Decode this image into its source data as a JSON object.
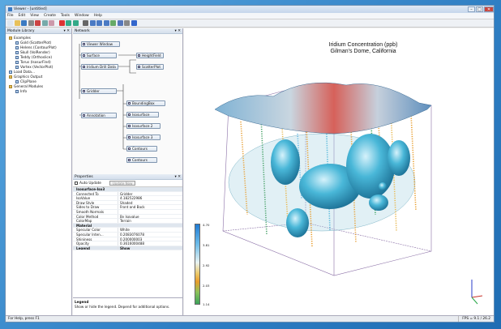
{
  "window": {
    "title": "Viewer - [untitled]"
  },
  "menu": [
    "File",
    "Edit",
    "View",
    "Create",
    "Tools",
    "Window",
    "Help"
  ],
  "toolbar_icons": [
    "new-icon",
    "open-icon",
    "save-icon",
    "print-icon",
    "cut-icon",
    "copy-icon",
    "paste-icon",
    "delete-icon",
    "undo-icon",
    "redo-icon",
    "pointer-icon",
    "zoom-icon",
    "rotate-icon",
    "pan-icon",
    "camera-icon",
    "view-icon",
    "settings-icon",
    "help-icon"
  ],
  "left_panel": {
    "title": "Module Library",
    "items": [
      {
        "label": "Examples",
        "level": 0,
        "type": "folder"
      },
      {
        "label": "Gold (ScatterPlot)",
        "level": 1,
        "type": "mod"
      },
      {
        "label": "Helens (ContourPlot)",
        "level": 1,
        "type": "mod"
      },
      {
        "label": "Skull (VolRender)",
        "level": 1,
        "type": "mod"
      },
      {
        "label": "Teddy (Orthoslice)",
        "level": 1,
        "type": "mod"
      },
      {
        "label": "Torus (IsosurFind)",
        "level": 1,
        "type": "mod"
      },
      {
        "label": "Vortex (VectorPlot)",
        "level": 1,
        "type": "mod"
      },
      {
        "label": "Load Data...",
        "level": 0,
        "type": "mod"
      },
      {
        "label": "Graphics Output",
        "level": 0,
        "type": "folder"
      },
      {
        "label": "ClipPlane",
        "level": 1,
        "type": "mod"
      },
      {
        "label": "General Modules",
        "level": 0,
        "type": "folder"
      },
      {
        "label": "Info",
        "level": 1,
        "type": "mod"
      }
    ]
  },
  "network": {
    "title": "Network",
    "nodes": [
      "Viewer Window",
      "Surface",
      "HeightField",
      "Iridium Drill Data",
      "ScatterPlot",
      "Gridder",
      "BoundingBox",
      "Isosurface",
      "Isosurface 2",
      "Isosurface 3",
      "Annotation",
      "Contours",
      "Contours"
    ]
  },
  "properties": {
    "title": "Properties",
    "auto_update": "Auto Update",
    "update_now": "Update Now",
    "rows": [
      {
        "k": "Isosurface-Iso3",
        "v": "",
        "section": true
      },
      {
        "k": "Connected To",
        "v": "Gridder"
      },
      {
        "k": "IsoValue",
        "v": "4.182522986"
      },
      {
        "k": "Draw Style",
        "v": "Shaded"
      },
      {
        "k": "Sides to Draw",
        "v": "Front and Back"
      },
      {
        "k": "Smooth Normals",
        "v": ""
      },
      {
        "k": "Color Method",
        "v": "By Isovalue"
      },
      {
        "k": "ColorMap",
        "v": "Terrain"
      },
      {
        "k": "Material",
        "v": "",
        "section": true
      },
      {
        "k": "Specular Color",
        "v": "White"
      },
      {
        "k": "Specular Inten...",
        "v": "0.2083076078"
      },
      {
        "k": "Shininess",
        "v": "0.200000003"
      },
      {
        "k": "Opacity",
        "v": "0.3616000488"
      },
      {
        "k": "Legend",
        "v": "Show",
        "section": true
      }
    ]
  },
  "legend_help": {
    "title": "Legend",
    "text": "Show or hide the legend. Depend for additional options."
  },
  "viewer": {
    "title_line1": "Iridium Concentration (ppb)",
    "title_line2": "Gilman's Dome, California",
    "colorbar_labels": [
      "4.70",
      "3.81",
      "2.92",
      "2.03",
      "1.14"
    ]
  },
  "status": {
    "left": "For Help, press F1",
    "right": "FPS = 9.1 / 26.2"
  }
}
